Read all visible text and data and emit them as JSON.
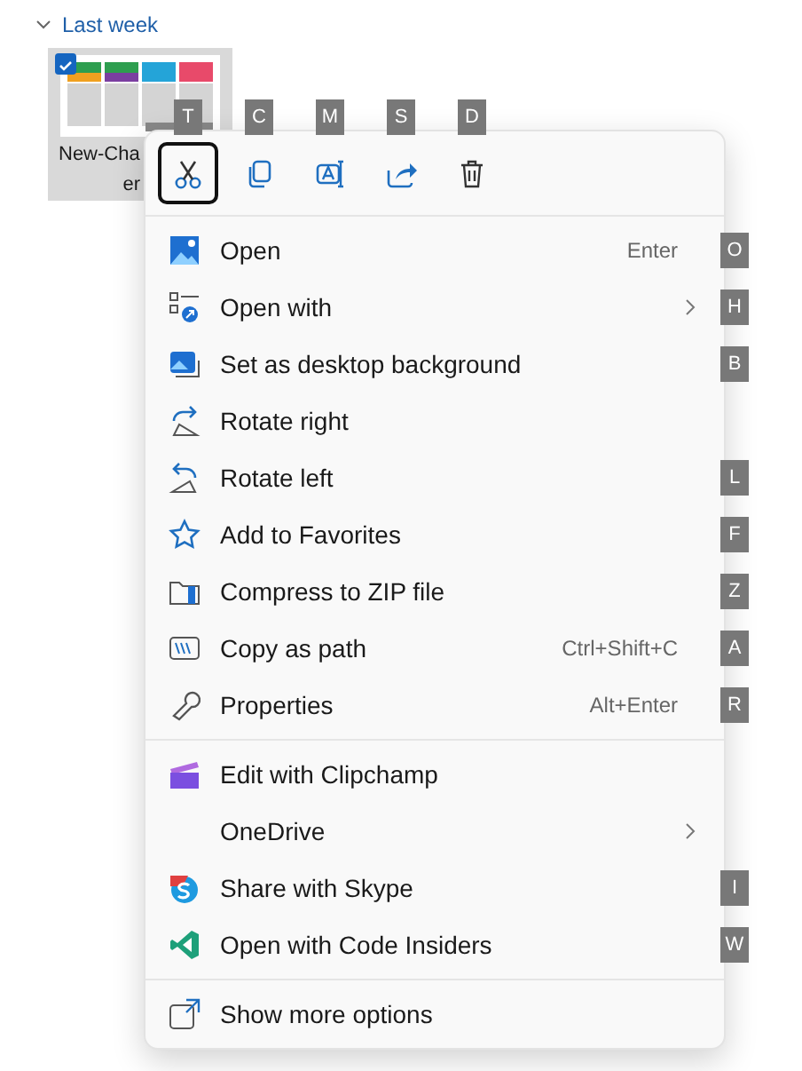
{
  "section": {
    "label": "Last week",
    "expanded": true
  },
  "file": {
    "name_lines": [
      "New-Cha",
      "er"
    ],
    "checked": true,
    "selected": true
  },
  "context_menu": {
    "toolbar": [
      {
        "kind": "cut",
        "keytip": "T",
        "focused": true
      },
      {
        "kind": "copy",
        "keytip": "C",
        "focused": false
      },
      {
        "kind": "rename",
        "keytip": "M",
        "focused": false
      },
      {
        "kind": "share",
        "keytip": "S",
        "focused": false
      },
      {
        "kind": "delete",
        "keytip": "D",
        "focused": false
      }
    ],
    "groups": [
      [
        {
          "kind": "open",
          "label": "Open",
          "shortcut": "Enter",
          "has_submenu": false,
          "keytip": "O"
        },
        {
          "kind": "openwith",
          "label": "Open with",
          "has_submenu": true,
          "keytip": "H"
        },
        {
          "kind": "wallpaper",
          "label": "Set as desktop background",
          "has_submenu": false,
          "keytip": "B"
        },
        {
          "kind": "rotright",
          "label": "Rotate right",
          "has_submenu": false
        },
        {
          "kind": "rotleft",
          "label": "Rotate left",
          "has_submenu": false,
          "keytip": "L"
        },
        {
          "kind": "star",
          "label": "Add to Favorites",
          "has_submenu": false,
          "keytip": "F"
        },
        {
          "kind": "zip",
          "label": "Compress to ZIP file",
          "has_submenu": false,
          "keytip": "Z"
        },
        {
          "kind": "path",
          "label": "Copy as path",
          "shortcut": "Ctrl+Shift+C",
          "has_submenu": false,
          "keytip": "A"
        },
        {
          "kind": "props",
          "label": "Properties",
          "shortcut": "Alt+Enter",
          "has_submenu": false,
          "keytip": "R"
        }
      ],
      [
        {
          "kind": "clipchamp",
          "label": "Edit with Clipchamp",
          "has_submenu": false
        },
        {
          "kind": "none",
          "label": "OneDrive",
          "has_submenu": true
        },
        {
          "kind": "skype",
          "label": "Share with Skype",
          "has_submenu": false,
          "keytip": "I"
        },
        {
          "kind": "code",
          "label": "Open with Code Insiders",
          "has_submenu": false,
          "keytip": "W"
        }
      ],
      [
        {
          "kind": "more",
          "label": "Show more options",
          "has_submenu": false
        }
      ]
    ]
  }
}
